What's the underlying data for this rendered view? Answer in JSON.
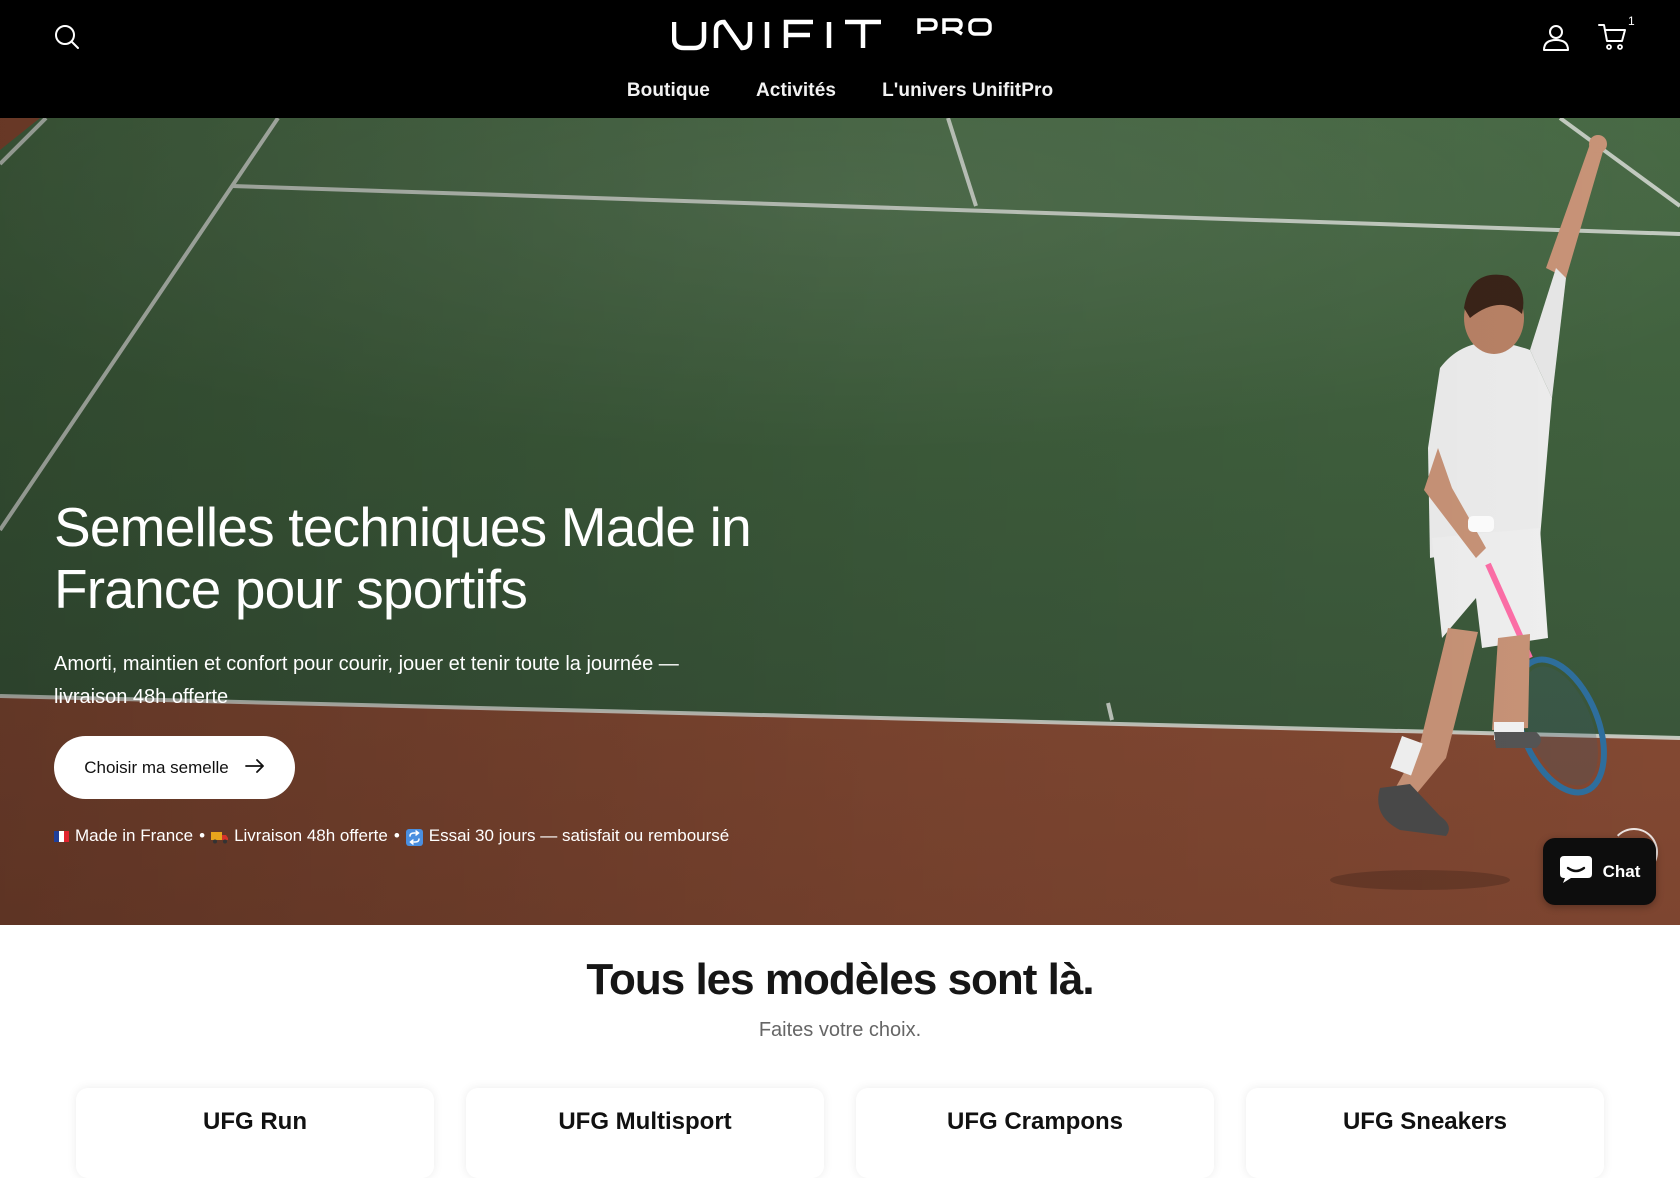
{
  "header": {
    "brand_name": "UNIFITPRO",
    "cart_count": "1",
    "nav": [
      {
        "label": "Boutique"
      },
      {
        "label": "Activités"
      },
      {
        "label": "L'univers UnifitPro"
      }
    ]
  },
  "hero": {
    "title": "Semelles techniques Made in France pour sportifs",
    "subtitle": "Amorti, maintien et confort pour courir, jouer et tenir toute la journée — livraison 48h offerte",
    "cta_label": "Choisir ma semelle",
    "badges": [
      {
        "icon": "france-flag-icon",
        "label": "Made in France"
      },
      {
        "icon": "delivery-truck-icon",
        "label": "Livraison 48h offerte"
      },
      {
        "icon": "repeat-icon",
        "label": "Essai 30 jours — satisfait ou remboursé"
      }
    ],
    "badge_separator": "•"
  },
  "chat": {
    "label": "Chat"
  },
  "models": {
    "title": "Tous les modèles sont là.",
    "subtitle": "Faites votre choix.",
    "cards": [
      {
        "title": "UFG Run"
      },
      {
        "title": "UFG Multisport"
      },
      {
        "title": "UFG Crampons"
      },
      {
        "title": "UFG Sneakers"
      }
    ]
  },
  "colors": {
    "header_bg": "#000000",
    "court_green": "#3c5a3c",
    "clay": "#8a4a32",
    "chat_bg": "#0d0d0d"
  }
}
